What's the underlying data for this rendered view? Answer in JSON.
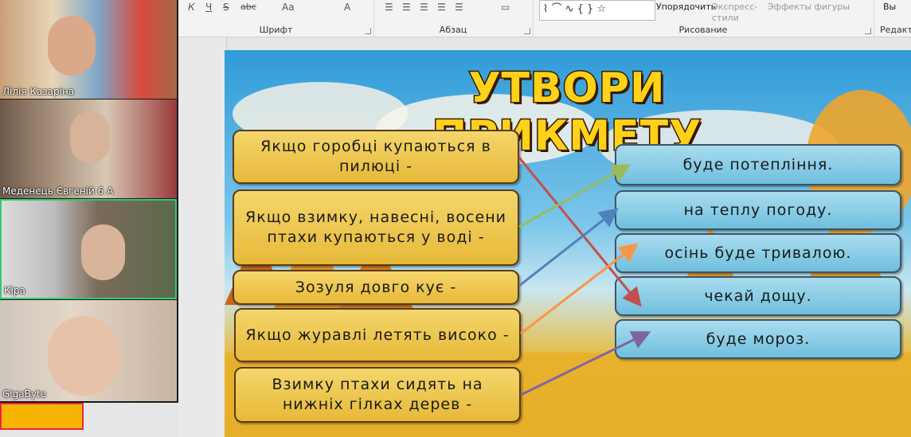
{
  "ribbon": {
    "font_group_label": "Шрифт",
    "font_tools": [
      "К",
      "Ч",
      "S",
      "abc",
      "Aa",
      "A"
    ],
    "paragraph_group_label": "Абзац",
    "drawing_group_label": "Рисование",
    "arrange_label": "Упорядочить",
    "quick_styles_label": "Экспресс-стили",
    "shape_effects_label": "Эффекты фигуры",
    "editing_group_label": "Редакт",
    "select_label": "Вы"
  },
  "participants": [
    {
      "name": "Лілія Казаріна"
    },
    {
      "name": "Меденець Євгеній 6 А"
    },
    {
      "name": "Кіра"
    },
    {
      "name": "GigaByte"
    }
  ],
  "slide": {
    "title": "УТВОРИ ПРИКМЕТУ",
    "left_items": [
      "Якщо горобці купаються в пилюці -",
      "Якщо взимку, навесні, восени птахи купаються у воді -",
      "Зозуля довго кує -",
      "Якщо журавлі летять високо -",
      "Взимку птахи сидять на нижніх гілках дерев -"
    ],
    "right_items": [
      "буде потепління.",
      "на теплу погоду.",
      "осінь буде тривалою.",
      "чекай дощу.",
      "буде мороз."
    ],
    "arrow_colors": [
      "#c0504d",
      "#9bbb59",
      "#4f81bd",
      "#f79646",
      "#8064a2"
    ]
  }
}
